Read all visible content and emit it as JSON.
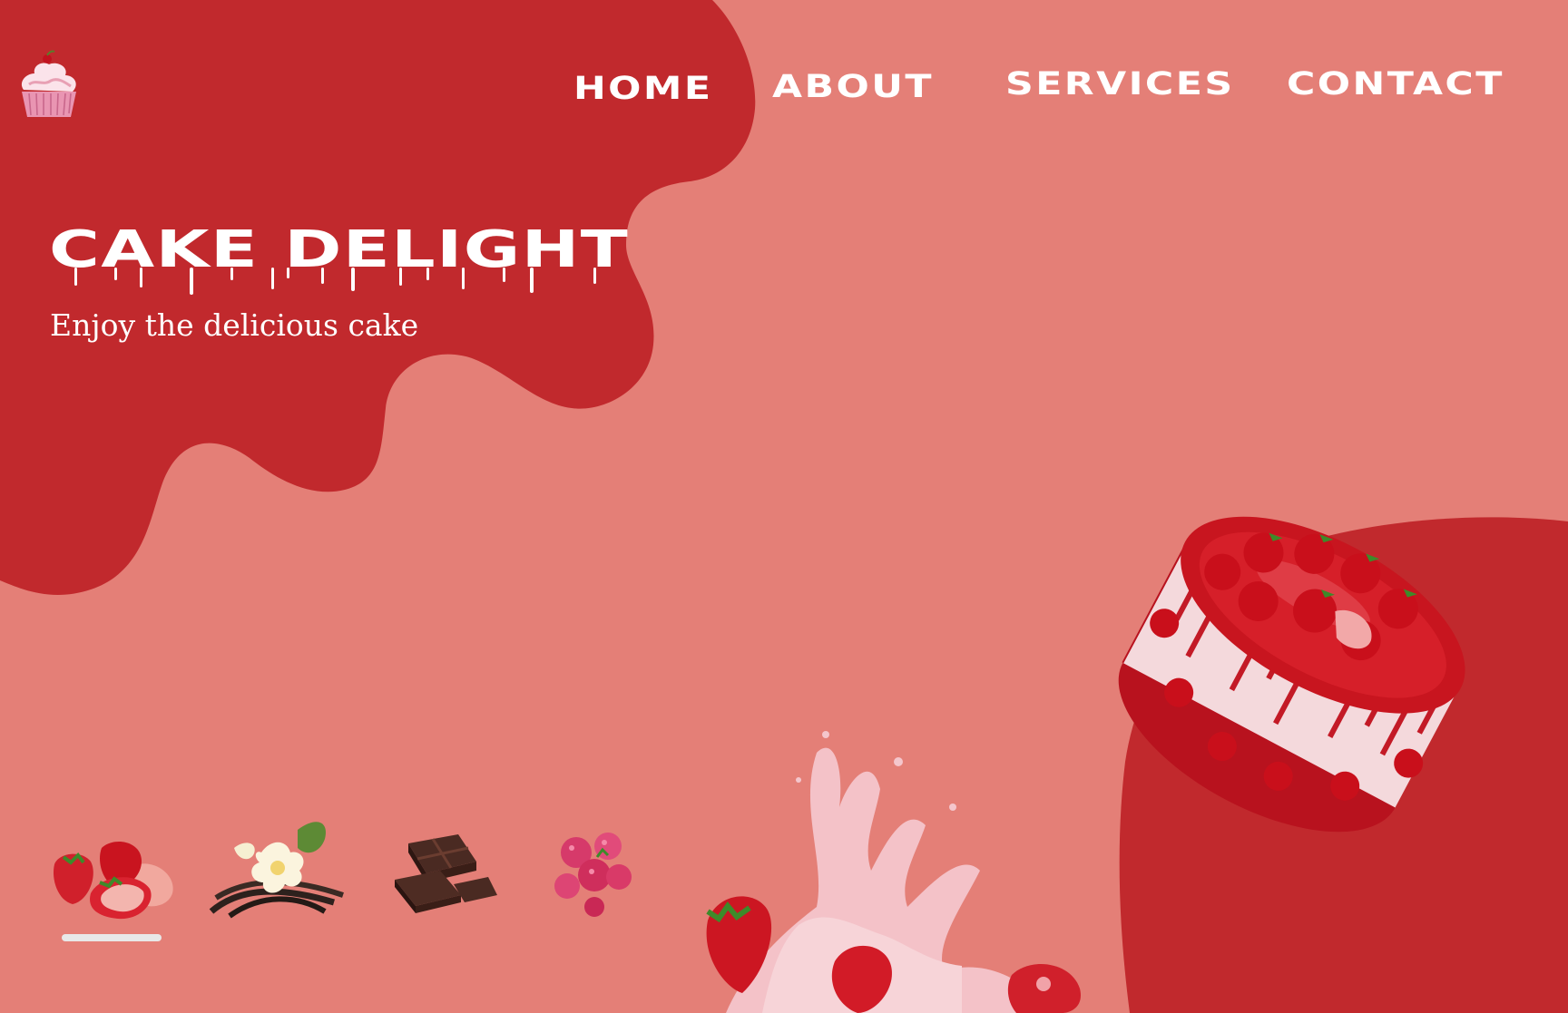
{
  "brand": {
    "logo_icon": "cupcake-icon"
  },
  "nav": {
    "items": [
      {
        "label": "HOME"
      },
      {
        "label": "ABOUT"
      },
      {
        "label": "SERVICES"
      },
      {
        "label": "CONTACT"
      }
    ]
  },
  "hero": {
    "title": "CAKE DELIGHT",
    "subtitle": "Enjoy the delicious cake"
  },
  "flavors": {
    "items": [
      {
        "icon": "strawberry-icon"
      },
      {
        "icon": "vanilla-flower-icon"
      },
      {
        "icon": "chocolate-icon"
      },
      {
        "icon": "raspberry-icon"
      }
    ],
    "active_index": 0
  },
  "images": {
    "splash": "milk-splash-strawberries-image",
    "cake": "strawberry-glazed-cake-image"
  },
  "colors": {
    "background": "#e47f77",
    "blob": "#c1292d",
    "text": "#ffffff",
    "indicator": "#e8e8e8"
  }
}
